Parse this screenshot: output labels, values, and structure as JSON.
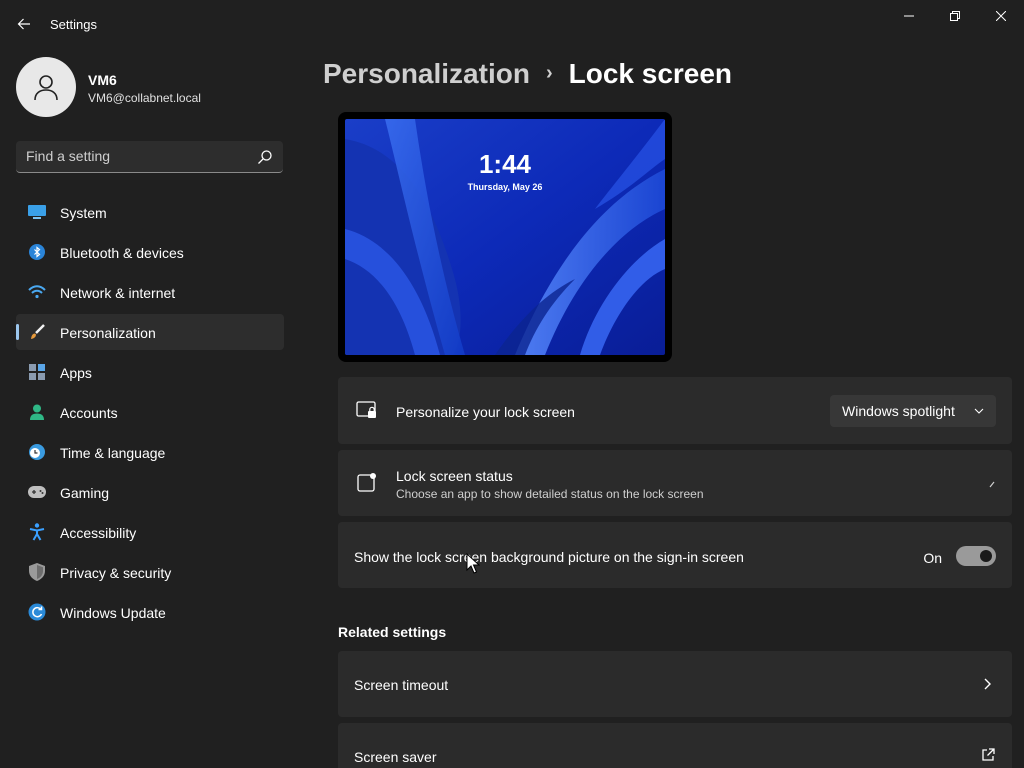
{
  "app": {
    "title": "Settings"
  },
  "profile": {
    "name": "VM6",
    "email": "VM6@collabnet.local"
  },
  "search": {
    "placeholder": "Find a setting"
  },
  "sidebar": {
    "items": [
      {
        "label": "System",
        "icon": "monitor-icon"
      },
      {
        "label": "Bluetooth & devices",
        "icon": "bluetooth-icon"
      },
      {
        "label": "Network & internet",
        "icon": "wifi-icon"
      },
      {
        "label": "Personalization",
        "icon": "brush-icon",
        "active": true
      },
      {
        "label": "Apps",
        "icon": "apps-icon"
      },
      {
        "label": "Accounts",
        "icon": "person-icon"
      },
      {
        "label": "Time & language",
        "icon": "clock-globe-icon"
      },
      {
        "label": "Gaming",
        "icon": "gamepad-icon"
      },
      {
        "label": "Accessibility",
        "icon": "accessibility-icon"
      },
      {
        "label": "Privacy & security",
        "icon": "shield-icon"
      },
      {
        "label": "Windows Update",
        "icon": "update-icon"
      }
    ]
  },
  "breadcrumb": {
    "parent": "Personalization",
    "separator": "›",
    "current": "Lock screen"
  },
  "preview": {
    "time": "1:44",
    "date": "Thursday, May 26"
  },
  "settings": {
    "personalize": {
      "title": "Personalize your lock screen",
      "value": "Windows spotlight"
    },
    "status": {
      "title": "Lock screen status",
      "subtitle": "Choose an app to show detailed status on the lock screen"
    },
    "signin_bg": {
      "title": "Show the lock screen background picture on the sign-in screen",
      "state": "On",
      "on": true
    }
  },
  "related": {
    "heading": "Related settings",
    "items": [
      {
        "label": "Screen timeout"
      },
      {
        "label": "Screen saver"
      }
    ]
  },
  "colors": {
    "background": "#202020",
    "card": "#2b2b2b",
    "accent": "#9cc7ee"
  }
}
